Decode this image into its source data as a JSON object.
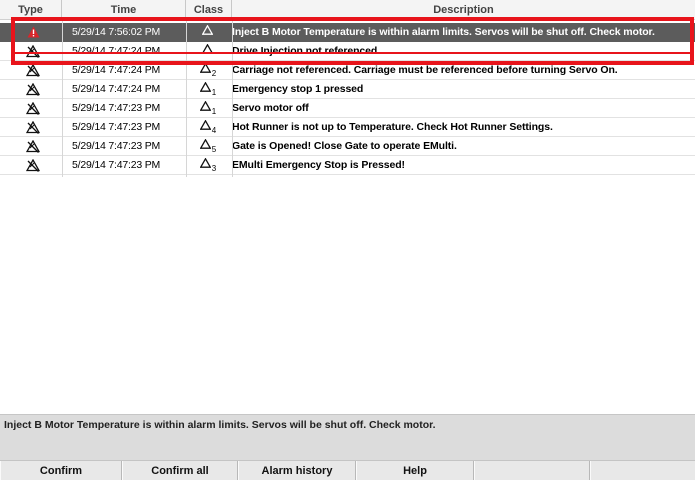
{
  "header": {
    "columns": [
      "Type",
      "Time",
      "Class",
      "Description"
    ]
  },
  "alarms": [
    {
      "type_icon": "warning-icon",
      "time": "5/29/14 7:56:02 PM",
      "class_num": "",
      "description": "Inject B Motor Temperature is within alarm limits. Servos will be shut off. Check motor."
    },
    {
      "type_icon": "alarm-cleared-icon",
      "time": "5/29/14 7:47:24 PM",
      "class_num": "",
      "description": "Drive Injection not referenced."
    },
    {
      "type_icon": "alarm-cleared-icon",
      "time": "5/29/14 7:47:24 PM",
      "class_num": "2",
      "description": "Carriage not referenced. Carriage must be referenced before turning Servo On."
    },
    {
      "type_icon": "alarm-cleared-icon",
      "time": "5/29/14 7:47:24 PM",
      "class_num": "1",
      "description": "Emergency stop 1 pressed"
    },
    {
      "type_icon": "alarm-cleared-icon",
      "time": "5/29/14 7:47:23 PM",
      "class_num": "1",
      "description": "Servo motor off"
    },
    {
      "type_icon": "alarm-cleared-icon",
      "time": "5/29/14 7:47:23 PM",
      "class_num": "4",
      "description": "Hot Runner is not up to Temperature. Check Hot Runner Settings."
    },
    {
      "type_icon": "alarm-cleared-icon",
      "time": "5/29/14 7:47:23 PM",
      "class_num": "5",
      "description": "Gate is Opened! Close Gate to operate EMulti."
    },
    {
      "type_icon": "alarm-cleared-icon",
      "time": "5/29/14 7:47:23 PM",
      "class_num": "3",
      "description": "EMulti Emergency Stop is Pressed!"
    }
  ],
  "status": {
    "message": "Inject B Motor Temperature is within alarm limits. Servos will be shut off. Check motor."
  },
  "toolbar": {
    "buttons": [
      "Confirm",
      "Confirm all",
      "Alarm history",
      "Help",
      "",
      ""
    ]
  },
  "colors": {
    "selected_row": "#5c5c5c",
    "highlight": "#e8141b",
    "warning": "#d8262b"
  }
}
